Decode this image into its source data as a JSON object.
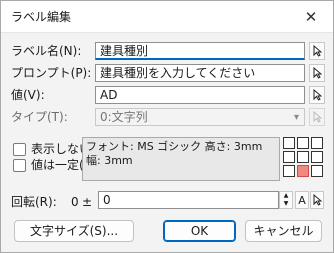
{
  "dialog": {
    "title": "ラベル編集",
    "close_symbol": "✕"
  },
  "fields": {
    "label_name": {
      "label": "ラベル名(N):",
      "value": "建具種別"
    },
    "prompt": {
      "label": "プロンプト(P):",
      "value": "建具種別を入力してください"
    },
    "value": {
      "label": "値(V):",
      "value": "AD"
    },
    "type": {
      "label": "タイプ(T):",
      "value": "0:文字列"
    }
  },
  "options": {
    "hidden": {
      "label": "表示しない(H)",
      "checked": false
    },
    "constant": {
      "label": "値は一定(C)",
      "checked": false
    }
  },
  "font_info": {
    "line1": "フォント: MS ゴシック 高さ: 3mm",
    "line2": "幅: 3mm"
  },
  "rotation": {
    "label": "回転(R):",
    "base": "0",
    "pm": "±",
    "value": "0",
    "font_btn": "A"
  },
  "buttons": {
    "font_size": "文字サイズ(S)...",
    "ok": "OK",
    "cancel": "キャンセル"
  },
  "colors": {
    "accent": "#0067c0",
    "anchor_active": "#f08a80"
  },
  "icons": {
    "picker": "cursor-arrow-icon",
    "spinner": "spin-arrows-icon"
  }
}
